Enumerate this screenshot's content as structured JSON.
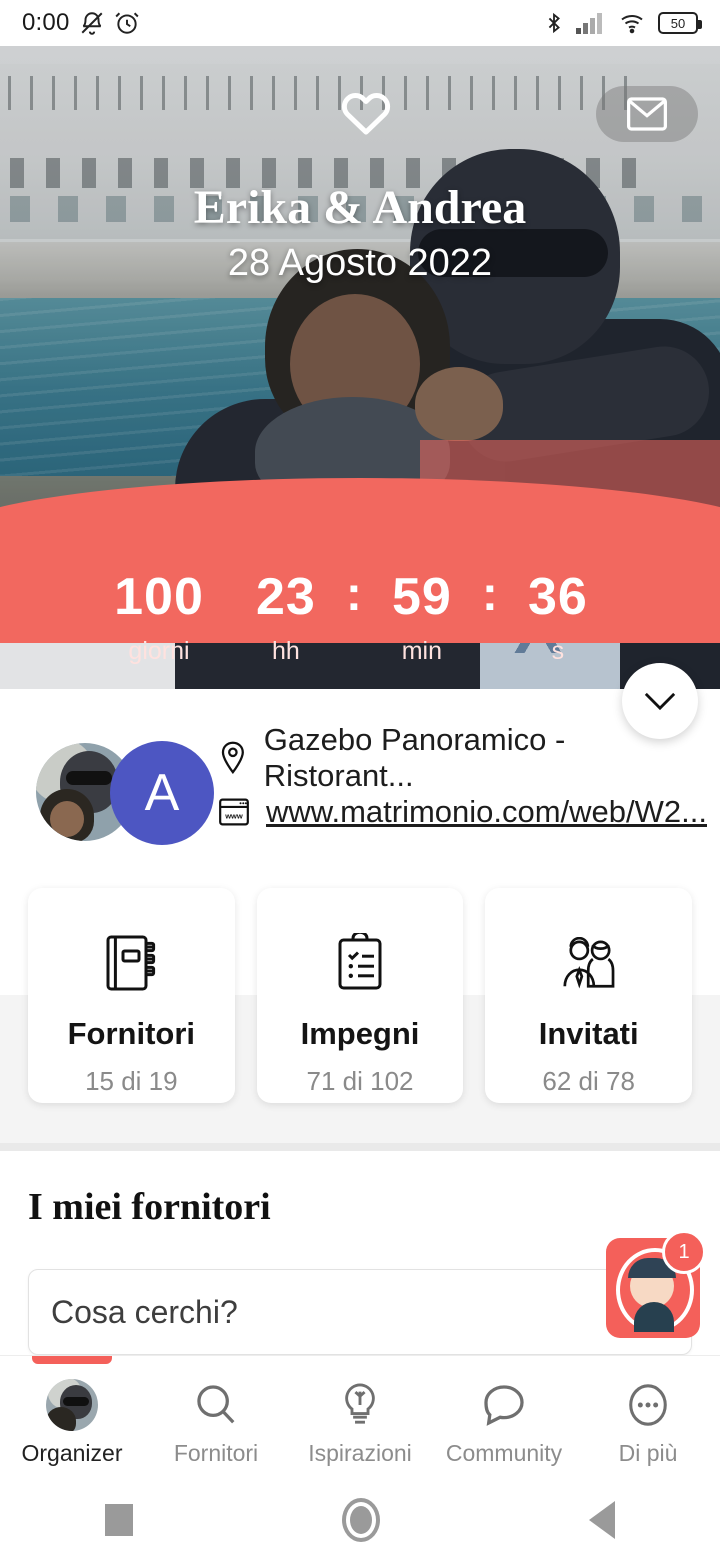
{
  "statusbar": {
    "time": "0:00",
    "icons_left": [
      "mute-icon",
      "alarm-icon"
    ],
    "icons_right": [
      "bluetooth-icon",
      "cellular-signal-icon",
      "wifi-icon",
      "battery-icon"
    ],
    "battery_level": "50"
  },
  "hero": {
    "couple_names": "Erika & Andrea",
    "wedding_date": "28 Agosto 2022",
    "heart_icon": "heart-icon",
    "mail_icon": "envelope-icon",
    "expand_icon": "chevron-down-icon"
  },
  "countdown": {
    "days_value": "100",
    "days_label": "giorni",
    "hours_value": "23",
    "hours_label": "hh",
    "separator": ":",
    "minutes_value": "59",
    "minutes_label": "min",
    "seconds_value": "36",
    "seconds_label": "s"
  },
  "info": {
    "avatar_letter": "A",
    "venue": "Gazebo Panoramico - Ristorant...",
    "venue_icon": "location-pin-icon",
    "website": "www.matrimonio.com/web/W2...",
    "website_icon": "www-browser-icon"
  },
  "cards": [
    {
      "title": "Fornitori",
      "subtitle": "15 di 19",
      "icon": "address-book-icon"
    },
    {
      "title": "Impegni",
      "subtitle": "71 di 102",
      "icon": "clipboard-checklist-icon"
    },
    {
      "title": "Invitati",
      "subtitle": "62 di 78",
      "icon": "guests-couple-icon"
    }
  ],
  "section": {
    "title": "I miei fornitori",
    "search_placeholder": "Cosa cerchi?"
  },
  "assistant": {
    "badge_count": "1",
    "icon": "assistant-avatar-icon"
  },
  "bottom_nav": [
    {
      "label": "Organizer",
      "icon": "profile-avatar-icon",
      "active": true
    },
    {
      "label": "Fornitori",
      "icon": "search-icon",
      "active": false
    },
    {
      "label": "Ispirazioni",
      "icon": "lightbulb-icon",
      "active": false
    },
    {
      "label": "Community",
      "icon": "speech-bubble-icon",
      "active": false
    },
    {
      "label": "Di più",
      "icon": "ellipsis-icon",
      "active": false
    }
  ],
  "system_nav": {
    "recents": "square-recents-icon",
    "home": "circle-home-icon",
    "back": "triangle-back-icon"
  },
  "colors": {
    "coral": "#f2685f",
    "avatar_purple": "#4d56c2",
    "accent_text": "#ffe2df"
  }
}
